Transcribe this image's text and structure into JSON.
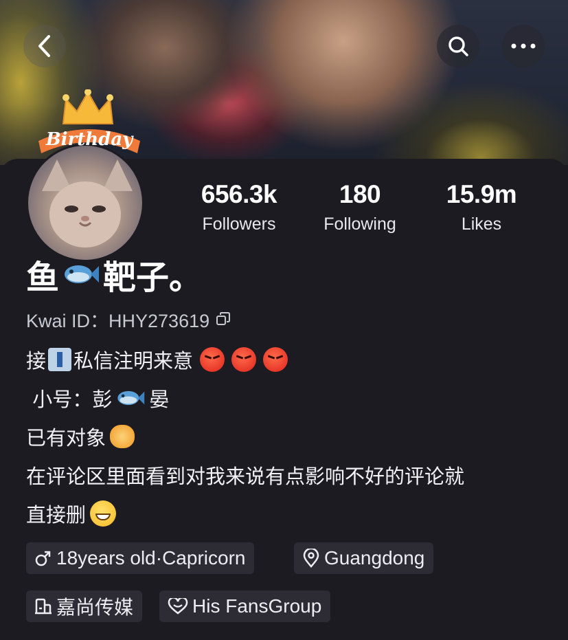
{
  "header": {
    "back_icon": "chevron-left-icon",
    "search_icon": "search-icon",
    "more_icon": "more-horizontal-icon"
  },
  "avatar": {
    "badge_text": "Birthday"
  },
  "stats": [
    {
      "value": "656.3k",
      "label": "Followers"
    },
    {
      "value": "180",
      "label": "Following"
    },
    {
      "value": "15.9m",
      "label": "Likes"
    }
  ],
  "profile": {
    "name_part1": "鱼",
    "name_part2": "靶子。",
    "kwai_id": "Kwai ID：HHY273619"
  },
  "bio": {
    "line1_a": "接",
    "line1_b": "私信注明来意",
    "line2_a": " 小号：彭",
    "line2_b": "晏",
    "line3": "已有对象",
    "line4": "在评论区里面看到对我来说有点影响不好的评论就",
    "line5": "直接删"
  },
  "tags": {
    "age": "18years old·Capricorn",
    "location": "Guangdong",
    "agency": "嘉尚传媒",
    "fans": "His FansGroup"
  },
  "colors": {
    "background": "#1c1b22",
    "tag_bg": "#2d2c35",
    "text": "#ffffff",
    "subtext": "#c9c9d1"
  }
}
